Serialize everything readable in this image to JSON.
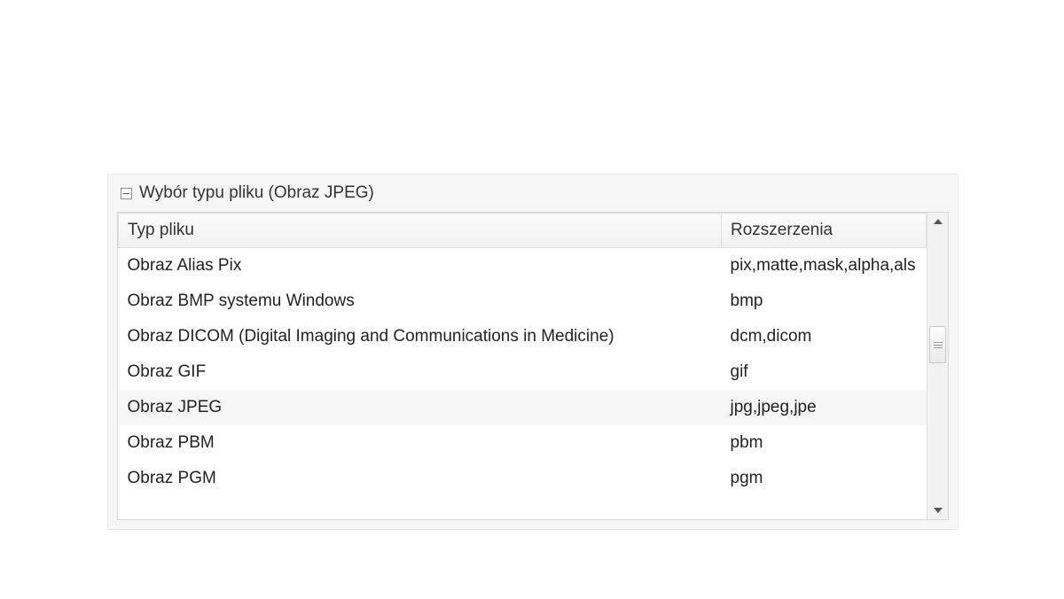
{
  "panel": {
    "title": "Wybór typu pliku (Obraz JPEG)"
  },
  "columns": {
    "type": "Typ pliku",
    "ext": "Rozszerzenia"
  },
  "rows": [
    {
      "type": "Obraz Alias Pix",
      "ext": "pix,matte,mask,alpha,als",
      "highlight": false
    },
    {
      "type": "Obraz BMP systemu Windows",
      "ext": "bmp",
      "highlight": false
    },
    {
      "type": "Obraz DICOM (Digital Imaging and Communications in Medicine)",
      "ext": "dcm,dicom",
      "highlight": false
    },
    {
      "type": "Obraz GIF",
      "ext": "gif",
      "highlight": false
    },
    {
      "type": "Obraz JPEG",
      "ext": "jpg,jpeg,jpe",
      "highlight": true
    },
    {
      "type": "Obraz PBM",
      "ext": "pbm",
      "highlight": false
    },
    {
      "type": "Obraz PGM",
      "ext": "pgm",
      "highlight": false
    }
  ]
}
